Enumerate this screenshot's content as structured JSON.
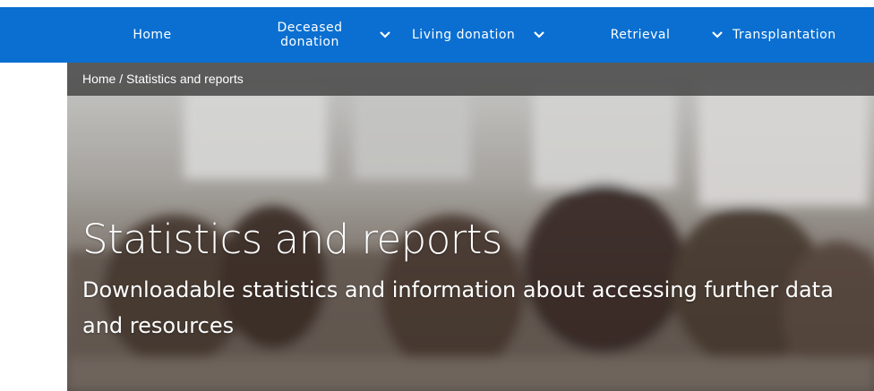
{
  "nav": {
    "items": [
      {
        "label": "Home",
        "has_dropdown": false
      },
      {
        "label": "Deceased donation",
        "has_dropdown": true
      },
      {
        "label": "Living donation",
        "has_dropdown": true
      },
      {
        "label": "Retrieval",
        "has_dropdown": true
      },
      {
        "label": "Transplantation",
        "has_dropdown": false
      }
    ],
    "background": "#0a6fd1"
  },
  "breadcrumb": "Home / Statistics and reports",
  "hero": {
    "title": "Statistics and reports",
    "subtitle": "Downloadable statistics and information about accessing further data and resources"
  }
}
